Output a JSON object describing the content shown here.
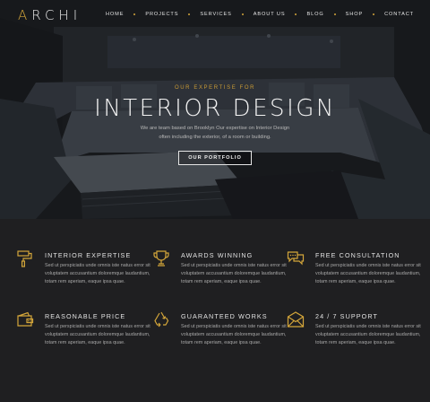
{
  "brand": {
    "logo_accent": "A",
    "logo_rest": "RCHI",
    "accent_color": "#d4a63a"
  },
  "nav": {
    "items": [
      "HOME",
      "PROJECTS",
      "SERVICES",
      "ABOUT US",
      "BLOG",
      "SHOP",
      "CONTACT"
    ]
  },
  "hero": {
    "eyebrow": "OUR EXPERTISE FOR",
    "title": "INTERIOR DESIGN",
    "line1": "We are team based on Brooklyn Our expertise on Interior Design",
    "line2": "often including the exterior, of a room or building.",
    "cta_label": "OUR PORTFOLIO"
  },
  "features": [
    {
      "icon": "paint-roller-icon",
      "title": "INTERIOR EXPERTISE",
      "text": "Sed ut perspiciatis unde omnis iste natus error sit voluptatem accusantium doloremque laudantium, totam rem aperiam, eaque ipsa quae."
    },
    {
      "icon": "trophy-icon",
      "title": "AWARDS WINNING",
      "text": "Sed ut perspiciatis unde omnis iste natus error sit voluptatem accusantium doloremque laudantium, totam rem aperiam, eaque ipsa quae."
    },
    {
      "icon": "chat-bubbles-icon",
      "title": "FREE CONSULTATION",
      "text": "Sed ut perspiciatis unde omnis iste natus error sit voluptatem accusantium doloremque laudantium, totam rem aperiam, eaque ipsa quae."
    },
    {
      "icon": "wallet-icon",
      "title": "REASONABLE PRICE",
      "text": "Sed ut perspiciatis unde omnis iste natus error sit voluptatem accusantium doloremque laudantium, totam rem aperiam, eaque ipsa quae."
    },
    {
      "icon": "recycle-icon",
      "title": "GUARANTEED WORKS",
      "text": "Sed ut perspiciatis unde omnis iste natus error sit voluptatem accusantium doloremque laudantium, totam rem aperiam, eaque ipsa quae."
    },
    {
      "icon": "envelope-icon",
      "title": "24 / 7 SUPPORT",
      "text": "Sed ut perspiciatis unde omnis iste natus error sit voluptatem accusantium doloremque laudantium, totam rem aperiam, eaque ipsa quae."
    }
  ]
}
